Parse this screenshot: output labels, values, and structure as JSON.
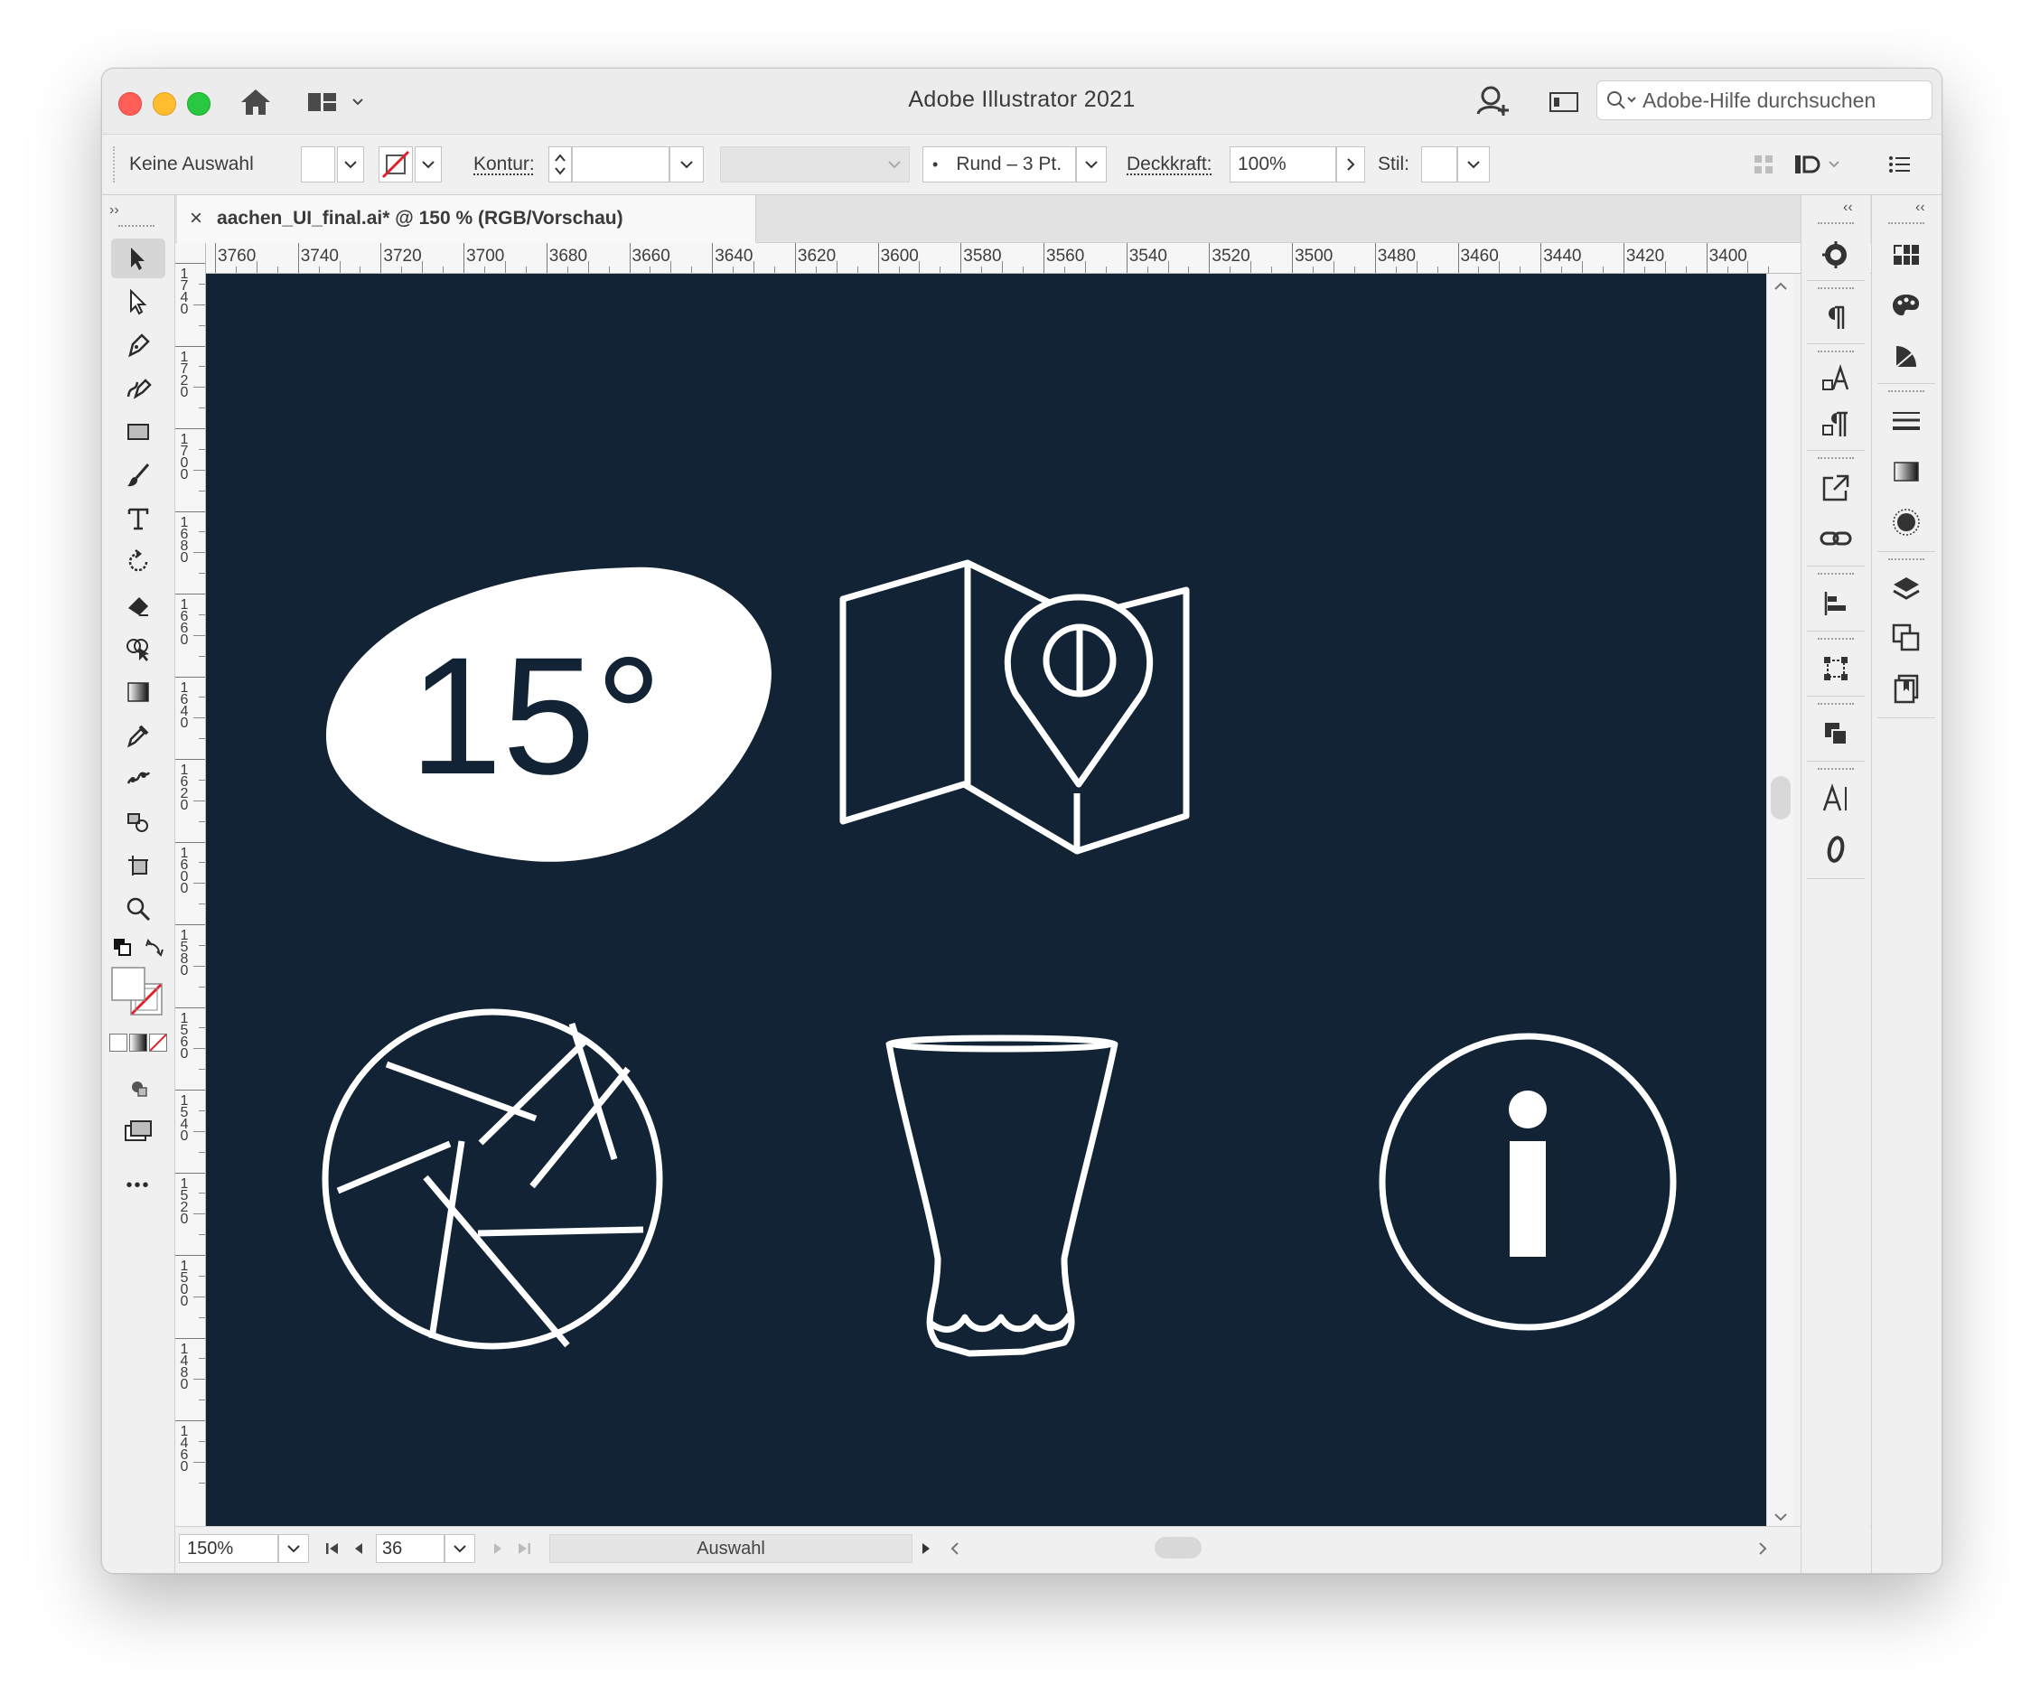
{
  "window": {
    "title": "Adobe Illustrator 2021",
    "help_search_placeholder": "Adobe-Hilfe durchsuchen"
  },
  "control_bar": {
    "selection_status": "Keine Auswahl",
    "stroke_label": "Kontur:",
    "brush_value": "Rund – 3 Pt.",
    "brush_bullet": "•",
    "opacity_label": "Deckkraft:",
    "opacity_value": "100%",
    "style_label": "Stil:"
  },
  "document": {
    "tab_title": "aachen_UI_final.ai* @ 150 % (RGB/Vorschau)",
    "close_glyph": "×",
    "canvas_color": "#112334",
    "artwork": {
      "temperature_label": "15°"
    }
  },
  "rulers": {
    "horizontal": [
      "3760",
      "3740",
      "3720",
      "3700",
      "3680",
      "3660",
      "3640",
      "3620",
      "3600",
      "3580",
      "3560",
      "3540",
      "3520",
      "3500",
      "3480",
      "3460",
      "3440",
      "3420",
      "3400"
    ],
    "vertical": [
      "1740",
      "1720",
      "1700",
      "1680",
      "1660",
      "1640",
      "1620",
      "1600",
      "1580",
      "1560",
      "1540",
      "1520",
      "1500",
      "1480",
      "1460"
    ]
  },
  "statusbar": {
    "zoom": "150%",
    "artboard_number": "36",
    "current_tool": "Auswahl"
  },
  "panels": {
    "collapse_glyph": "‹‹",
    "expand_glyph": "››"
  },
  "toolbar": {
    "more_tools_glyph": "•••"
  }
}
